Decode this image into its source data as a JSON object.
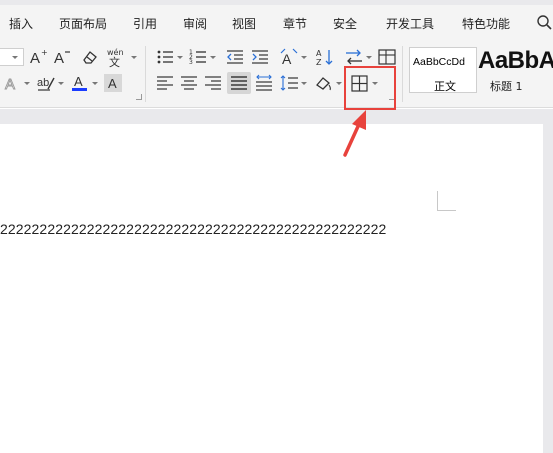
{
  "menubar": {
    "tabs": [
      "插入",
      "页面布局",
      "引用",
      "审阅",
      "视图",
      "章节",
      "安全",
      "开发工具",
      "特色功能"
    ]
  },
  "ribbon": {
    "style_gallery": {
      "normal_preview": "AaBbCcDd",
      "normal_label": "正文",
      "heading_preview": "AaBbA",
      "heading_label": "标题 1"
    }
  },
  "document": {
    "text": "2222222222222222222222222222222222222222222222222"
  },
  "colors": {
    "font_color_bar": "#1a3cff",
    "highlight_annotation": "#e8423c"
  }
}
